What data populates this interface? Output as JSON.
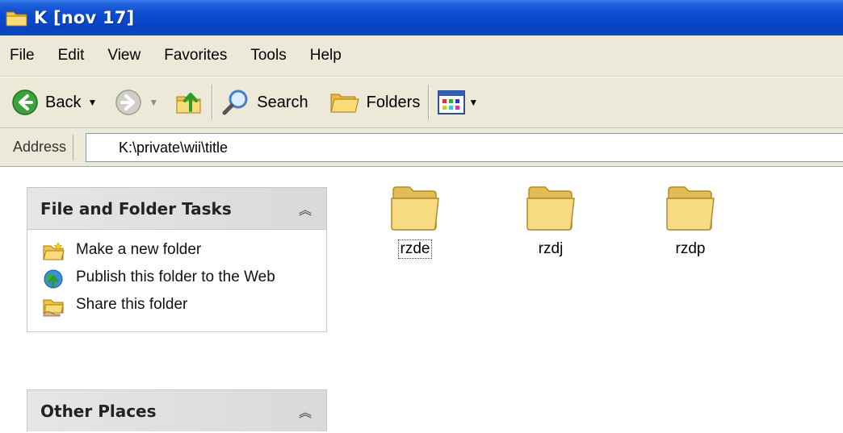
{
  "window": {
    "title": "K [nov 17]",
    "icon": "folder-icon"
  },
  "menubar": {
    "items": [
      "File",
      "Edit",
      "View",
      "Favorites",
      "Tools",
      "Help"
    ]
  },
  "toolbar": {
    "back_label": "Back",
    "search_label": "Search",
    "folders_label": "Folders"
  },
  "address": {
    "label": "Address",
    "value": "K:\\private\\wii\\title"
  },
  "tasks": {
    "file_folder_title": "File and Folder Tasks",
    "items": [
      {
        "label": "Make a new folder",
        "icon": "new-folder-icon"
      },
      {
        "label": "Publish this folder to the Web",
        "icon": "publish-web-icon"
      },
      {
        "label": "Share this folder",
        "icon": "share-folder-icon"
      }
    ],
    "other_places_title": "Other Places"
  },
  "folders": [
    {
      "name": "rzde",
      "focused": true
    },
    {
      "name": "rzdj",
      "focused": false
    },
    {
      "name": "rzdp",
      "focused": false
    }
  ],
  "colors": {
    "titlebar": "#0a4ad0",
    "chrome": "#ece9d8",
    "folder": "#f5d77a"
  }
}
